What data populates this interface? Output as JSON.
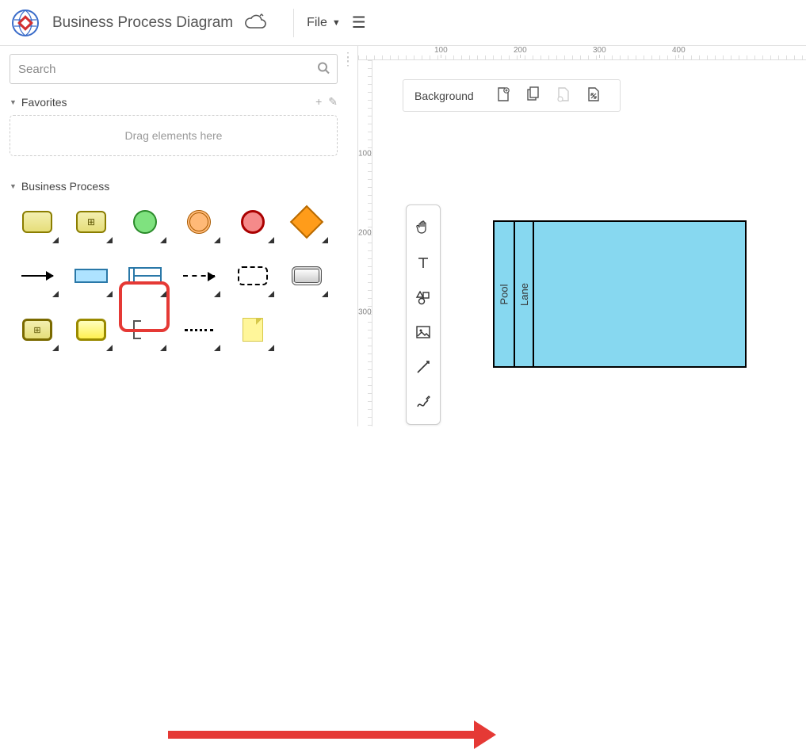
{
  "header": {
    "title": "Business Process Diagram",
    "file_menu_label": "File"
  },
  "sidebar": {
    "search_placeholder": "Search",
    "favorites": {
      "title": "Favorites",
      "drop_hint": "Drag elements here"
    },
    "palette": {
      "title": "Business Process",
      "shapes": [
        {
          "name": "task"
        },
        {
          "name": "subprocess"
        },
        {
          "name": "start-event"
        },
        {
          "name": "intermediate-event"
        },
        {
          "name": "end-event"
        },
        {
          "name": "gateway"
        },
        {
          "name": "sequence-flow"
        },
        {
          "name": "pool"
        },
        {
          "name": "lane"
        },
        {
          "name": "message-flow"
        },
        {
          "name": "event-subprocess"
        },
        {
          "name": "transaction"
        },
        {
          "name": "call-activity"
        },
        {
          "name": "call-activity-2"
        },
        {
          "name": "text-annotation"
        },
        {
          "name": "association"
        },
        {
          "name": "sticky-note"
        }
      ]
    }
  },
  "canvas": {
    "bg_toolbar_label": "Background",
    "ruler_h": [
      100,
      200,
      300,
      400
    ],
    "ruler_v": [
      100,
      200,
      300
    ],
    "pool_label": "Pool",
    "lane_label": "Lane"
  }
}
